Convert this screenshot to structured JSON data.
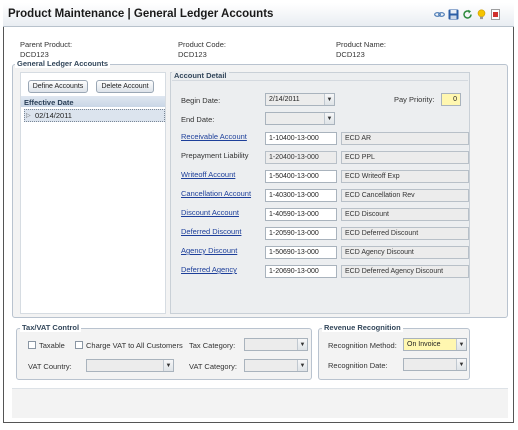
{
  "header": {
    "title": "Product Maintenance  |  General Ledger Accounts",
    "icons": [
      "link-icon",
      "save-icon",
      "refresh-icon",
      "tip-icon",
      "report-icon"
    ]
  },
  "product": {
    "parent_label": "Parent Product:",
    "parent_value": "DCD123",
    "code_label": "Product Code:",
    "code_value": "DCD123",
    "name_label": "Product Name:",
    "name_value": "DCD123"
  },
  "gl_accounts": {
    "title": "General Ledger Accounts",
    "define_button": "Define Accounts",
    "delete_button": "Delete Account",
    "tree_header": "Effective Date",
    "tree_items": [
      "02/14/2011"
    ]
  },
  "account_detail": {
    "title": "Account Detail",
    "begin_date_label": "Begin Date:",
    "begin_date_value": "2/14/2011",
    "end_date_label": "End Date:",
    "end_date_value": "",
    "pay_priority_label": "Pay Priority:",
    "pay_priority_value": "0",
    "accounts": [
      {
        "label": "Receivable Account",
        "is_link": true,
        "number": "1-10400-13-000",
        "description": "ECD AR"
      },
      {
        "label": "Prepayment Liability",
        "is_link": false,
        "number": "1-20400-13-000",
        "description": "ECD PPL"
      },
      {
        "label": "Writeoff Account",
        "is_link": true,
        "number": "1-50400-13-000",
        "description": "ECD Writeoff Exp"
      },
      {
        "label": "Cancellation Account",
        "is_link": true,
        "number": "1-40300-13-000",
        "description": "ECD Cancellation Rev"
      },
      {
        "label": "Discount Account",
        "is_link": true,
        "number": "1-40590-13-000",
        "description": "ECD Discount"
      },
      {
        "label": "Deferred Discount",
        "is_link": true,
        "number": "1-20590-13-000",
        "description": "ECD Deferred Discount"
      },
      {
        "label": "Agency Discount",
        "is_link": true,
        "number": "1-50690-13-000",
        "description": "ECD Agency Discount"
      },
      {
        "label": "Deferred Agency",
        "is_link": true,
        "number": "1-20690-13-000",
        "description": "ECD Deferred Agency Discount"
      }
    ]
  },
  "tax_vat": {
    "title": "Tax/VAT Control",
    "taxable_label": "Taxable",
    "charge_vat_label": "Charge VAT to All Customers",
    "tax_category_label": "Tax Category:",
    "tax_category_value": "",
    "vat_country_label": "VAT Country:",
    "vat_country_value": "",
    "vat_category_label": "VAT Category:",
    "vat_category_value": ""
  },
  "revenue": {
    "title": "Revenue Recognition",
    "method_label": "Recognition Method:",
    "method_value": "On Invoice",
    "date_label": "Recognition Date:",
    "date_value": ""
  },
  "colors": {
    "link": "#1d3f9a",
    "highlight": "#fff7b0",
    "group_title": "#33475b"
  }
}
